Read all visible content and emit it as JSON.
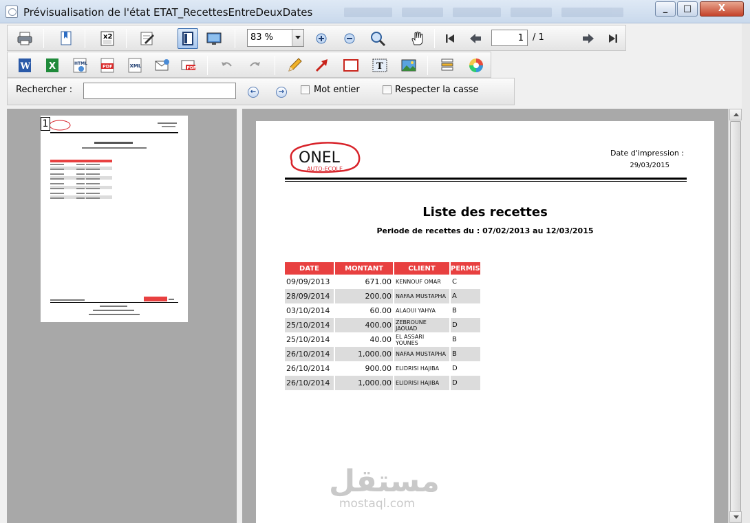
{
  "window": {
    "title": "Prévisualisation de l'état ETAT_RecettesEntreDeuxDates",
    "min_label": "_",
    "max_label": "□",
    "close_label": "X"
  },
  "toolbar": {
    "zoom_value": "83 %",
    "page_value": "1",
    "page_total": "/ 1",
    "icons_row1": [
      "print-icon",
      "bookmark-icon",
      "two-pages-icon",
      "edit-icon",
      "single-page-view-icon",
      "full-screen-icon",
      "zoom-in-icon",
      "zoom-out-icon",
      "zoom-icon",
      "hand-icon",
      "first-page-icon",
      "previous-page-icon",
      "next-page-icon",
      "last-page-icon"
    ],
    "icons_row2": [
      "word-export-icon",
      "excel-export-icon",
      "html-export-icon",
      "pdf-export-icon",
      "xml-export-icon",
      "email-icon",
      "email-pdf-icon",
      "undo-icon",
      "redo-icon",
      "pencil-icon",
      "arrow-draw-icon",
      "rectangle-icon",
      "text-box-icon",
      "image-icon",
      "layers-icon",
      "color-wheel-icon"
    ],
    "export_labels": {
      "html": "HTML",
      "pdf": "PDF",
      "xml": "XML",
      "pdf2": "PDF"
    }
  },
  "search": {
    "label": "Rechercher :",
    "value": "",
    "whole_word": "Mot entier",
    "match_case": "Respecter la casse"
  },
  "thumbnail": {
    "page_number": "1"
  },
  "report": {
    "logo_text": "ONEL",
    "logo_sub": "AUTO-ECOLE",
    "print_date_label": "Date d'impression :",
    "print_date": "29/03/2015",
    "title": "Liste des recettes",
    "period": "Periode de recettes du  : 07/02/2013    au    12/03/2015",
    "columns": [
      "DATE",
      "MONTANT",
      "CLIENT",
      "PERMIS"
    ],
    "rows": [
      [
        "09/09/2013",
        "671.00",
        "KENNOUF OMAR",
        "C"
      ],
      [
        "28/09/2014",
        "200.00",
        "NAFAA MUSTAPHA",
        "A"
      ],
      [
        "03/10/2014",
        "60.00",
        "ALAOUI YAHYA",
        "B"
      ],
      [
        "25/10/2014",
        "400.00",
        "ZEBROUNE JAOUAD",
        "D"
      ],
      [
        "25/10/2014",
        "40.00",
        "EL ASSARI YOUNES",
        "B"
      ],
      [
        "26/10/2014",
        "1,000.00",
        "NAFAA MUSTAPHA",
        "B"
      ],
      [
        "26/10/2014",
        "900.00",
        "ELIDRISI HAJIBA",
        "D"
      ],
      [
        "26/10/2014",
        "1,000.00",
        "ELIDRISI HAJIBA",
        "D"
      ]
    ]
  },
  "watermark": {
    "arabic": "مستقل",
    "latin": "mostaql.com"
  },
  "colors": {
    "table_header": "#e84040",
    "logo_red": "#d8232a",
    "pane_bg": "#a9a9a9"
  }
}
